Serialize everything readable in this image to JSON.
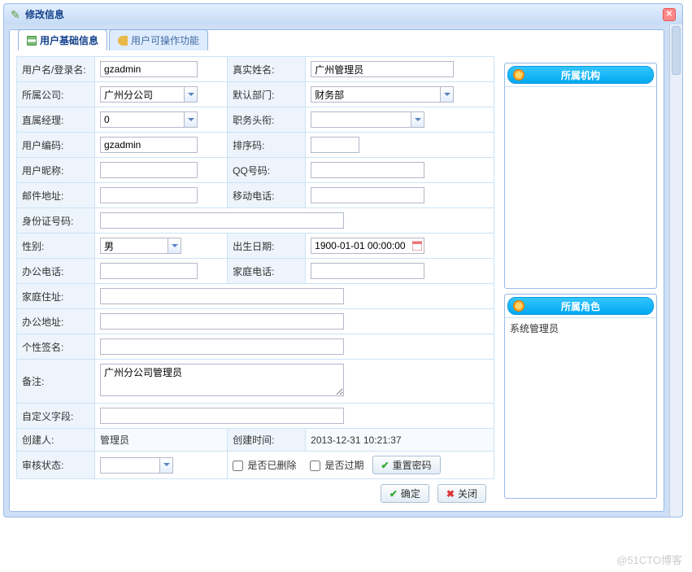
{
  "window": {
    "title": "修改信息"
  },
  "tabs": {
    "basic": "用户基础信息",
    "ops": "用户可操作功能"
  },
  "labels": {
    "username": "用户名/登录名:",
    "realname": "真实姓名:",
    "company": "所属公司:",
    "defaultDept": "默认部门:",
    "manager": "直属经理:",
    "title": "职务头衔:",
    "usercode": "用户编码:",
    "sortcode": "排序码:",
    "nickname": "用户昵称:",
    "qq": "QQ号码:",
    "email": "邮件地址:",
    "mobile": "移动电话:",
    "idcard": "身份证号码:",
    "gender": "性别:",
    "birthday": "出生日期:",
    "officePhone": "办公电话:",
    "homePhone": "家庭电话:",
    "homeAddr": "家庭住址:",
    "officeAddr": "办公地址:",
    "signature": "个性签名:",
    "remark": "备注:",
    "custom": "自定义字段:",
    "creator": "创建人:",
    "createTime": "创建时间:",
    "auditStatus": "审核状态:",
    "isDeleted": "是否已删除",
    "isExpired": "是否过期"
  },
  "values": {
    "username": "gzadmin",
    "realname": "广州管理员",
    "company": "广州分公司",
    "defaultDept": "财务部",
    "manager": "0",
    "title": "",
    "usercode": "gzadmin",
    "sortcode": "",
    "nickname": "",
    "qq": "",
    "email": "",
    "mobile": "",
    "idcard": "",
    "gender": "男",
    "birthday": "1900-01-01 00:00:00",
    "officePhone": "",
    "homePhone": "",
    "homeAddr": "",
    "officeAddr": "",
    "signature": "",
    "remark": "广州分公司管理员",
    "custom": "",
    "creator": "管理员",
    "createTime": "2013-12-31 10:21:37",
    "auditStatus": ""
  },
  "buttons": {
    "resetPwd": "重置密码",
    "ok": "确定",
    "close": "关闭"
  },
  "side": {
    "org": {
      "title": "所属机构",
      "items": []
    },
    "role": {
      "title": "所属角色",
      "items": [
        "系统管理员"
      ]
    }
  },
  "watermark": "@51CTO博客"
}
